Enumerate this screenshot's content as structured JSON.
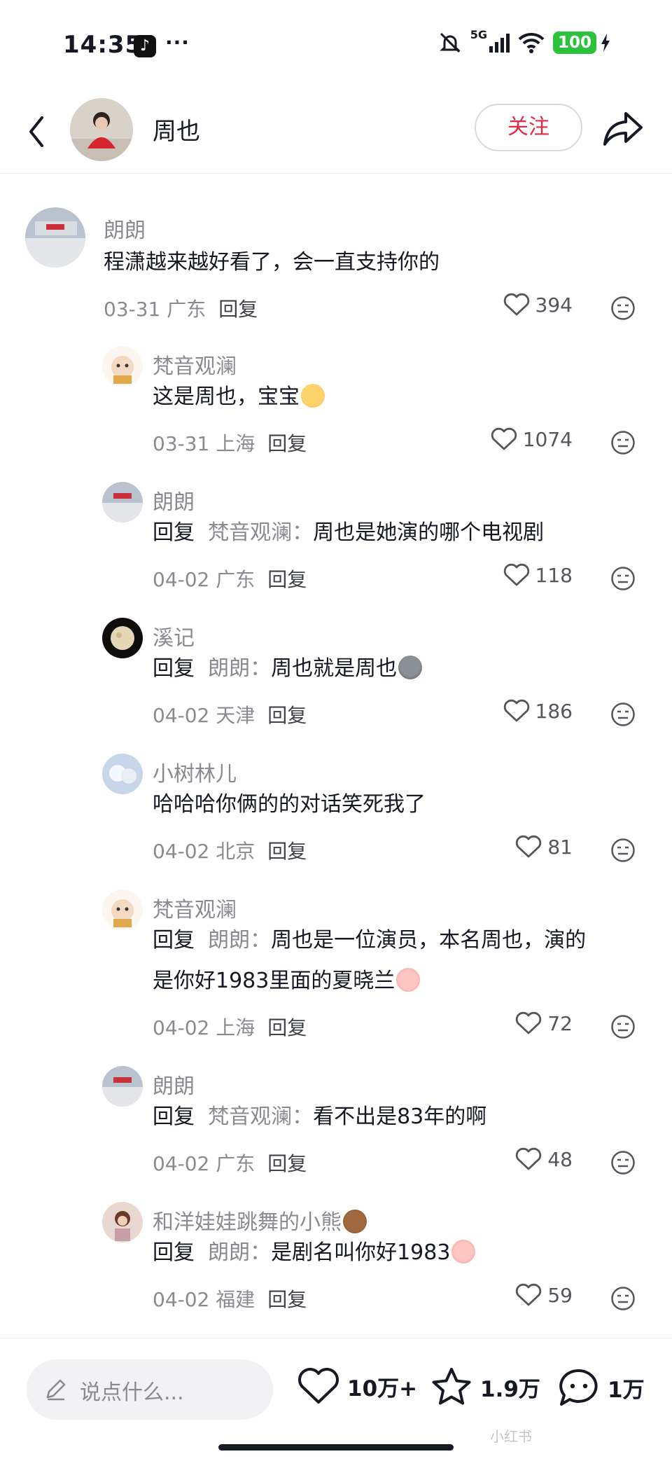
{
  "status_bar": {
    "time": "14:35",
    "network": "5G",
    "battery": "100"
  },
  "header": {
    "name": "周也",
    "follow_label": "关注"
  },
  "comments": [
    {
      "name": "朗朗",
      "text": "程潇越来越好看了，会一直支持你的",
      "date_loc": "03-31 广东",
      "reply_label": "回复",
      "likes": "394"
    },
    {
      "name": "梵音观澜",
      "text": "这是周也，宝宝",
      "date_loc": "03-31 上海",
      "reply_label": "回复",
      "likes": "1074"
    },
    {
      "name": "朗朗",
      "reply_prefix": "回复",
      "reply_to": "梵音观澜：",
      "text": "周也是她演的哪个电视剧",
      "date_loc": "04-02 广东",
      "reply_label": "回复",
      "likes": "118"
    },
    {
      "name": "溪记",
      "reply_prefix": "回复",
      "reply_to": "朗朗：",
      "text": "周也就是周也",
      "date_loc": "04-02 天津",
      "reply_label": "回复",
      "likes": "186"
    },
    {
      "name": "小树林儿",
      "text": "哈哈哈你俩的的对话笑死我了",
      "date_loc": "04-02 北京",
      "reply_label": "回复",
      "likes": "81"
    },
    {
      "name": "梵音观澜",
      "reply_prefix": "回复",
      "reply_to": "朗朗：",
      "text": "周也是一位演员，本名周也，演的",
      "text_line2": "是你好1983里面的夏晓兰",
      "date_loc": "04-02 上海",
      "reply_label": "回复",
      "likes": "72"
    },
    {
      "name": "朗朗",
      "reply_prefix": "回复",
      "reply_to": "梵音观澜：",
      "text": "看不出是83年的啊",
      "date_loc": "04-02 广东",
      "reply_label": "回复",
      "likes": "48"
    },
    {
      "name": "和洋娃娃跳舞的小熊",
      "reply_prefix": "回复",
      "reply_to": "朗朗：",
      "text": "是剧名叫你好1983",
      "date_loc": "04-02 福建",
      "reply_label": "回复",
      "likes": "59"
    }
  ],
  "bottom_bar": {
    "input_placeholder": "说点什么...",
    "likes": "10万+",
    "favorites": "1.9万",
    "comments": "1万",
    "watermark": "小红书"
  },
  "colors": {
    "accent": "#e02b45",
    "battery": "#2bc23c",
    "muted": "#8a8b91"
  }
}
